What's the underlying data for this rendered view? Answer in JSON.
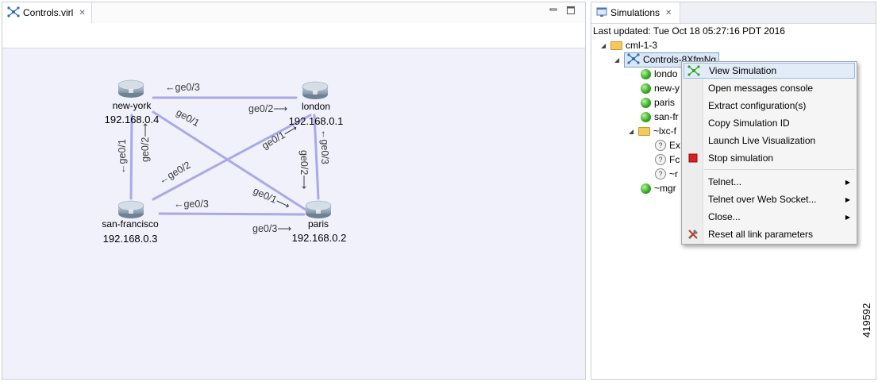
{
  "editor": {
    "tab_label": "Controls.virl",
    "minimize_glyph": "▭",
    "maximize_glyph": "▢",
    "nodes": {
      "new_york": {
        "name": "new-york",
        "ip": "192.168.0.4"
      },
      "london": {
        "name": "london",
        "ip": "192.168.0.1"
      },
      "san_francisco": {
        "name": "san-francisco",
        "ip": "192.168.0.3"
      },
      "paris": {
        "name": "paris",
        "ip": "192.168.0.2"
      }
    },
    "links": {
      "ny_london_ny": "←ge0/3",
      "ny_london_london": "ge0/2⟶",
      "ny_paris_ny": "ge0/1",
      "ny_sf_ny": "ge0/2⟶",
      "ny_sf_sf": "←ge0/1",
      "london_sf_london": "ge0/1⟶",
      "london_sf_sf": "←ge0/2",
      "london_paris_london": "←ge0/3",
      "london_paris_paris": "ge0/2⟶",
      "sf_paris_sf": "←ge0/3",
      "ny_paris_paris": "ge0/1⟶",
      "sf_paris_paris": "ge0/3⟶"
    },
    "link_color": "#a9a9e6"
  },
  "simulations": {
    "tab_label": "Simulations",
    "last_updated": "Last updated: Tue Oct 18 05:27:16 PDT 2016",
    "tree": {
      "server": "cml-1-3",
      "simulation": "Controls-8XfmNq",
      "nodes": [
        "londo",
        "new-y",
        "paris",
        "san-fr"
      ],
      "lxc_folder": "~lxc-f",
      "lxc_items": [
        "Ex",
        "Fc",
        "~r"
      ],
      "mgmt": "~mgr"
    }
  },
  "context_menu": {
    "items": [
      {
        "label": "View Simulation",
        "icon": "topology-icon",
        "highlighted": true
      },
      {
        "label": "Open messages console"
      },
      {
        "label": "Extract configuration(s)"
      },
      {
        "label": "Copy Simulation ID"
      },
      {
        "label": "Launch Live Visualization"
      },
      {
        "label": "Stop simulation",
        "icon": "stop-icon"
      },
      {
        "label": "Telnet...",
        "submenu": true
      },
      {
        "label": "Telnet over Web Socket...",
        "submenu": true
      },
      {
        "label": "Close...",
        "submenu": true
      },
      {
        "label": "Reset all link parameters",
        "icon": "tools-icon"
      }
    ]
  },
  "figure_id": "419592",
  "colors": {
    "accent_green": "#2fa51d",
    "stop_red": "#d42222",
    "highlight": "#e2ecf9"
  }
}
